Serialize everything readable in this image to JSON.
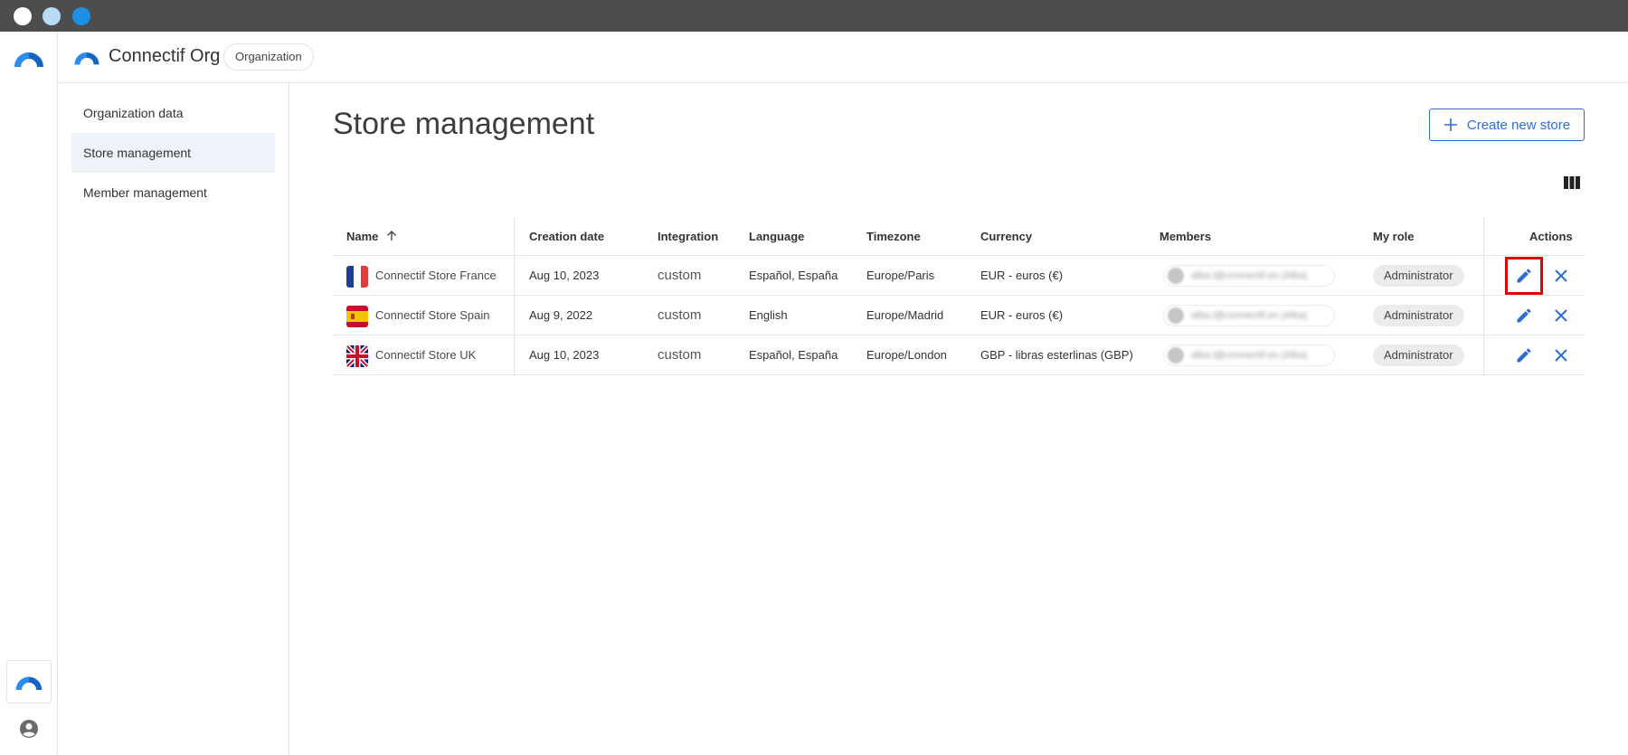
{
  "app": {
    "org_name": "Connectif Org",
    "org_badge": "Organization"
  },
  "sidebar": {
    "items": [
      {
        "label": "Organization data",
        "active": false
      },
      {
        "label": "Store management",
        "active": true
      },
      {
        "label": "Member management",
        "active": false
      }
    ]
  },
  "main": {
    "title": "Store management",
    "create_button": "Create new store",
    "columns_icon": "view-column-icon"
  },
  "table": {
    "headers": [
      "Name",
      "Creation date",
      "Integration",
      "Language",
      "Timezone",
      "Currency",
      "Members",
      "My role",
      "Actions"
    ],
    "sort_icon": "arrow-up-icon",
    "rows": [
      {
        "flag": "france-flag",
        "name": "Connectif Store France",
        "creation_date": "Aug 10, 2023",
        "integration": "custom",
        "language": "Español, España",
        "timezone": "Europe/Paris",
        "currency": "EUR - euros (€)",
        "member": "alba.l@connectif.es (Alba)",
        "role": "Administrator",
        "edit_highlighted": true
      },
      {
        "flag": "spain-flag",
        "name": "Connectif Store Spain",
        "creation_date": "Aug 9, 2022",
        "integration": "custom",
        "language": "English",
        "timezone": "Europe/Madrid",
        "currency": "EUR - euros (€)",
        "member": "alba.l@connectif.es (Alba)",
        "role": "Administrator",
        "edit_highlighted": false
      },
      {
        "flag": "uk-flag",
        "name": "Connectif Store UK",
        "creation_date": "Aug 10, 2023",
        "integration": "custom",
        "language": "Español, España",
        "timezone": "Europe/London",
        "currency": "GBP - libras esterlinas (GBP)",
        "member": "alba.l@connectif.es (Alba)",
        "role": "Administrator",
        "edit_highlighted": false
      }
    ]
  },
  "colors": {
    "accent": "#2b6fd1",
    "highlight": "#e00000",
    "titlebar": "#4d4d4d"
  }
}
